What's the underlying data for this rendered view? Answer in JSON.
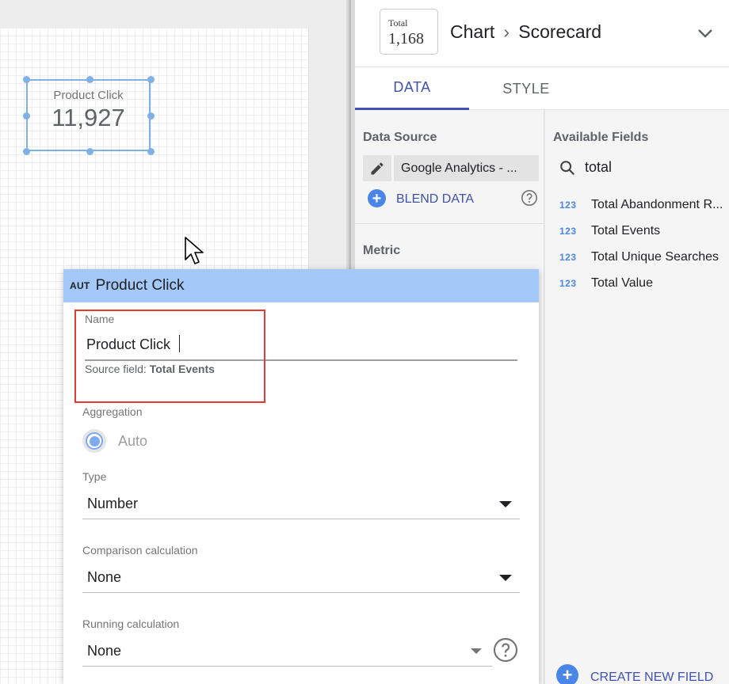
{
  "canvas": {
    "scorecard": {
      "label": "Product Click",
      "value": "11,927"
    }
  },
  "panel": {
    "thumbnail": {
      "label": "Total",
      "value": "1,168"
    },
    "breadcrumb": {
      "parent": "Chart",
      "separator": "›",
      "current": "Scorecard"
    },
    "tabs": [
      {
        "label": "DATA",
        "active": true
      },
      {
        "label": "STYLE",
        "active": false
      }
    ],
    "data_source": {
      "title": "Data Source",
      "source_name": "Google Analytics - ...",
      "blend_label": "BLEND DATA"
    },
    "metric": {
      "title": "Metric"
    },
    "available_fields": {
      "title": "Available Fields",
      "search_value": "total",
      "items": [
        {
          "type": "123",
          "name": "Total Abandonment R..."
        },
        {
          "type": "123",
          "name": "Total Events"
        },
        {
          "type": "123",
          "name": "Total Unique Searches"
        },
        {
          "type": "123",
          "name": "Total Value"
        }
      ],
      "create_label": "CREATE NEW FIELD"
    }
  },
  "field_editor": {
    "type_badge": "AUT",
    "title": "Product Click",
    "name_label": "Name",
    "name_value": "Product Click",
    "source_field_prefix": "Source field:",
    "source_field_value": "Total Events",
    "aggregation_label": "Aggregation",
    "aggregation_value": "Auto",
    "type_label": "Type",
    "type_value": "Number",
    "comparison_label": "Comparison calculation",
    "comparison_value": "None",
    "running_label": "Running calculation",
    "running_value": "None"
  },
  "colors": {
    "accent": "#3f51b5",
    "selection": "#7fb0e6",
    "editor_header": "#a4c8f8",
    "highlight": "#e53935"
  }
}
